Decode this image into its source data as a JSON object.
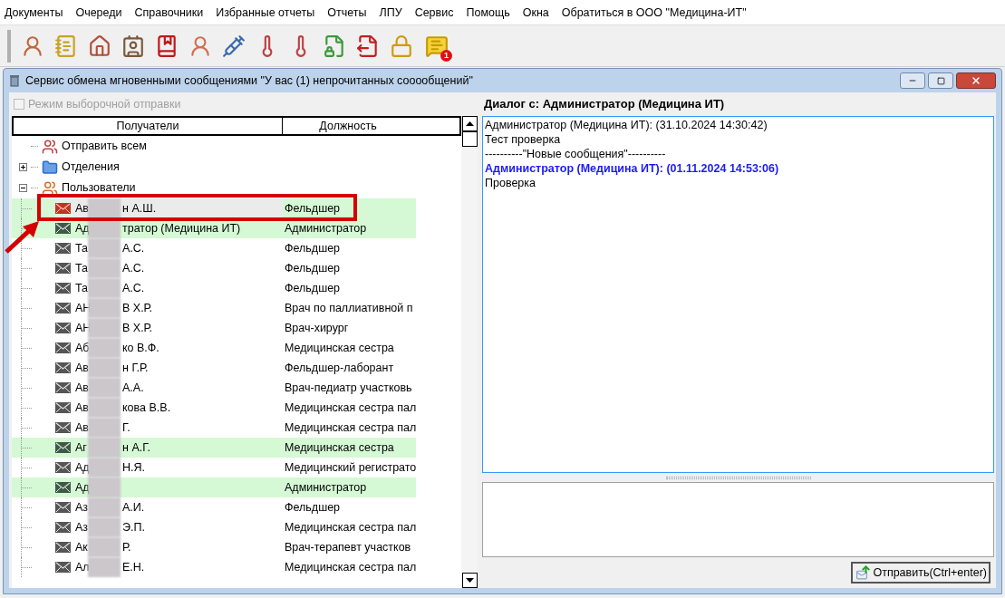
{
  "menu": [
    "Документы",
    "Очереди",
    "Справочники",
    "Избранные отчеты",
    "Отчеты",
    "ЛПУ",
    "Сервис",
    "Помощь",
    "Окна",
    "Обратиться в ООО \"Медицина-ИТ\""
  ],
  "toolbar": {
    "badge": "1"
  },
  "window": {
    "title": "Сервис обмена мгновенными сообщениями \"У вас (1) непрочитанных сооообщений\""
  },
  "selective_mode": {
    "label": "Режим выборочной отправки",
    "checked": false,
    "disabled": true
  },
  "columns": [
    "Получатели",
    "Должность"
  ],
  "tree": [
    {
      "kind": "action",
      "label": "Отправить всем"
    },
    {
      "kind": "group",
      "label": "Отделения",
      "expanded": false
    },
    {
      "kind": "group",
      "label": "Пользователи",
      "expanded": true,
      "children": [
        {
          "name_start": "Ав",
          "name_end": "н А.Ш.",
          "position": "Фельдшер",
          "online": true,
          "unread": true,
          "selected": true
        },
        {
          "name_start": "Ад",
          "name_end": "тратор (Медицина ИТ)",
          "position": "Администратор",
          "online": true,
          "unread": false,
          "selected": false
        },
        {
          "name_start": "Та",
          "name_end": "А.С.",
          "position": "Фельдшер",
          "online": false,
          "unread": false,
          "selected": false
        },
        {
          "name_start": "Та",
          "name_end": "А.С.",
          "position": "Фельдшер",
          "online": false,
          "unread": false,
          "selected": false
        },
        {
          "name_start": "Та",
          "name_end": "А.С.",
          "position": "Фельдшер",
          "online": false,
          "unread": false,
          "selected": false
        },
        {
          "name_start": "АН",
          "name_end": "В Х.Р.",
          "position": "Врач по паллиативной п",
          "online": false,
          "unread": false,
          "selected": false
        },
        {
          "name_start": "АН",
          "name_end": "В Х.Р.",
          "position": "Врач-хирург",
          "online": false,
          "unread": false,
          "selected": false
        },
        {
          "name_start": "Аб",
          "name_end": "ко В.Ф.",
          "position": "Медицинская сестра",
          "online": false,
          "unread": false,
          "selected": false
        },
        {
          "name_start": "Ав",
          "name_end": "н Г.Р.",
          "position": "Фельдшер-лаборант",
          "online": false,
          "unread": false,
          "selected": false
        },
        {
          "name_start": "Ав",
          "name_end": "А.А.",
          "position": "Врач-педиатр участковь",
          "online": false,
          "unread": false,
          "selected": false
        },
        {
          "name_start": "Ав",
          "name_end": "кова В.В.",
          "position": "Медицинская сестра пал",
          "online": false,
          "unread": false,
          "selected": false
        },
        {
          "name_start": "Ав",
          "name_end": "Г.",
          "position": "Медицинская сестра пал",
          "online": false,
          "unread": false,
          "selected": false
        },
        {
          "name_start": "Аг",
          "name_end": "н А.Г.",
          "position": "Медицинская сестра",
          "online": true,
          "unread": false,
          "selected": false
        },
        {
          "name_start": "Ад",
          "name_end": "Н.Я.",
          "position": "Медицинский регистрато",
          "online": false,
          "unread": false,
          "selected": false
        },
        {
          "name_start": "Ад",
          "position": "Администратор",
          "online": true,
          "unread": false,
          "selected": false
        },
        {
          "name_start": "Аз",
          "name_end": "А.И.",
          "position": "Фельдшер",
          "online": false,
          "unread": false,
          "selected": false
        },
        {
          "name_start": "Аз",
          "name_end": "Э.П.",
          "position": "Медицинская сестра пал",
          "online": false,
          "unread": false,
          "selected": false
        },
        {
          "name_start": "Ак",
          "name_end": "Р.",
          "position": "Врач-терапевт участков",
          "online": false,
          "unread": false,
          "selected": false
        },
        {
          "name_start": "Ал",
          "name_end": "Е.Н.",
          "position": "Медицинская сестра пал",
          "online": false,
          "unread": false,
          "selected": false
        }
      ]
    }
  ],
  "dialog": {
    "title": "Диалог с:  Администратор (Медицина ИТ)",
    "messages": [
      {
        "kind": "author",
        "text": "Администратор (Медицина ИТ): (31.10.2024 14:30:42)"
      },
      {
        "kind": "text",
        "text": "Тест проверка"
      },
      {
        "kind": "text",
        "text": "----------\"Новые сообщения\"----------"
      },
      {
        "kind": "author_new",
        "text": "Администратор (Медицина ИТ): (01.11.2024 14:53:06)"
      },
      {
        "kind": "text",
        "text": "Проверка"
      }
    ],
    "send_button": "Отправить(Ctrl+enter)"
  }
}
